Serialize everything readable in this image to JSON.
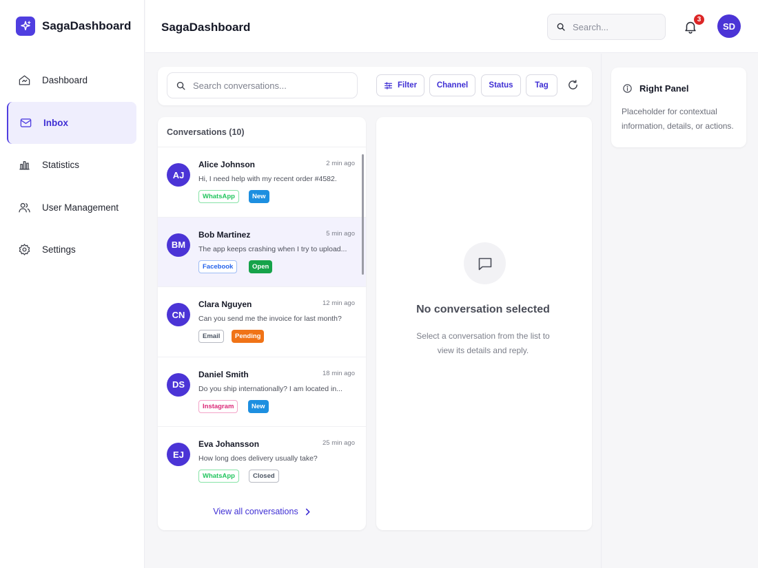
{
  "app": {
    "brand": "SagaDashboard",
    "page_title": "SagaDashboard"
  },
  "sidebar": {
    "items": [
      {
        "label": "Dashboard",
        "icon": "home-icon",
        "active": false
      },
      {
        "label": "Inbox",
        "icon": "inbox-icon",
        "active": true
      },
      {
        "label": "Statistics",
        "icon": "bar-chart-icon",
        "active": false
      },
      {
        "label": "User Management",
        "icon": "users-icon",
        "active": false
      },
      {
        "label": "Settings",
        "icon": "gear-icon",
        "active": false
      }
    ]
  },
  "header": {
    "search_placeholder": "Search...",
    "notifications_count": "3",
    "user_initials": "SD"
  },
  "toolbar": {
    "search_placeholder": "Search conversations...",
    "filter_label": "Filter",
    "channel_label": "Channel",
    "status_label": "Status",
    "tag_label": "Tag"
  },
  "conversations": {
    "header": "Conversations (10)",
    "items": [
      {
        "initials": "AJ",
        "name": "Alice Johnson",
        "time": "2 min ago",
        "preview": "Hi, I need help with my recent order #4582.",
        "channel": "WhatsApp",
        "status": "New",
        "selected": false
      },
      {
        "initials": "BM",
        "name": "Bob Martinez",
        "time": "5 min ago",
        "preview": "The app keeps crashing when I try to upload...",
        "channel": "Facebook",
        "status": "Open",
        "selected": true
      },
      {
        "initials": "CN",
        "name": "Clara Nguyen",
        "time": "12 min ago",
        "preview": "Can you send me the invoice for last month?",
        "channel": "Email",
        "status": "Pending",
        "selected": false
      },
      {
        "initials": "DS",
        "name": "Daniel Smith",
        "time": "18 min ago",
        "preview": "Do you ship internationally? I am located in...",
        "channel": "Instagram",
        "status": "New",
        "selected": false
      },
      {
        "initials": "EJ",
        "name": "Eva Johansson",
        "time": "25 min ago",
        "preview": "How long does delivery usually take?",
        "channel": "WhatsApp",
        "status": "Closed",
        "selected": false
      }
    ],
    "view_all_label": "View all conversations"
  },
  "detail": {
    "empty_title": "No conversation selected",
    "empty_subtitle": "Select a conversation from the list to view its details and reply."
  },
  "right_panel": {
    "title": "Right Panel",
    "text": "Placeholder for contextual information, details, or actions."
  },
  "colors": {
    "accent": "#4f3ee0",
    "whatsapp": "#22c55e",
    "facebook": "#2563eb",
    "email": "#6b7280",
    "instagram": "#db2777",
    "status_new": "#1d8fe0",
    "status_open": "#16a34a",
    "status_pending": "#f07317",
    "status_closed": "#6b7280"
  }
}
